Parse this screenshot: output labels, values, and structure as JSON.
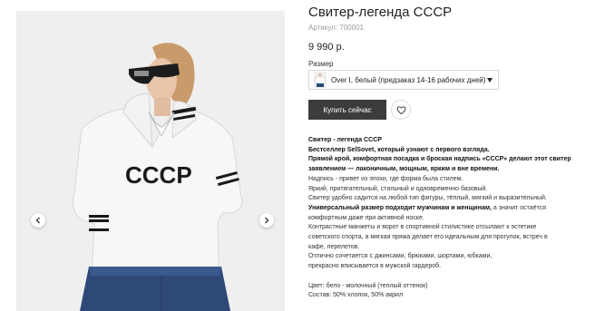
{
  "colors": {
    "button_bg": "#3c3c3c",
    "button_text": "#ffffff",
    "gallery_bg": "#f0f0f0",
    "sku_text": "#999999"
  },
  "gallery": {
    "prev_icon": "chevron-left-icon",
    "next_icon": "chevron-right-icon",
    "photo_print": "CCCP"
  },
  "product": {
    "title": "Свитер-легенда СССР",
    "sku": "Артикул: 700001",
    "price": "9 990 р.",
    "size_label": "Размер",
    "variant_selected": "Over I, белый (предзаказ 14-16 рабочих дней)",
    "buy_label": "Купить сейчас",
    "wishlist_icon": "heart-icon"
  },
  "description": {
    "heading": "Свитер - легенда СССР",
    "intro": "Бестселлер SelSovet, который узнают с первого взгляда.",
    "highlight_1": "Прямой крой, комфортная посадка и броская надпись «СССР» делают этот свитер",
    "highlight_2": "заявлением — лаконичным, мощным, ярким и вне времени.",
    "line_1": "Надпись - привет из эпохи, где форма была стилем.",
    "line_2": "Яркий, притягательный, стильный и одновременно базовый.",
    "line_3": "Свитер удобно садится на любой тип фигуры, тёплый, мягкий и выразительный.",
    "line_4_bold": "Универсальный размер подходит мужчинам и женщинам,",
    "line_4_rest": " а значит остаётся",
    "line_5": "комфортным даже при активной носке.",
    "line_6": "Контрастные манжеты и ворот в спортивной стилистике отсылают к эстетике",
    "line_7": "советского спорта, а мягкая пряжа делает его идеальным для прогулок, встреч в",
    "line_8": "кафе, перелетов.",
    "line_9": "Отлично сочетается с джинсами, брюками, шортами, юбками,",
    "line_10": "прекрасно вписывается в мужской гардероб.",
    "color_line": "Цвет: бело - молочный (теплый оттенок)",
    "composition_line": "Состав: 50% хлопок, 50% акрил"
  }
}
